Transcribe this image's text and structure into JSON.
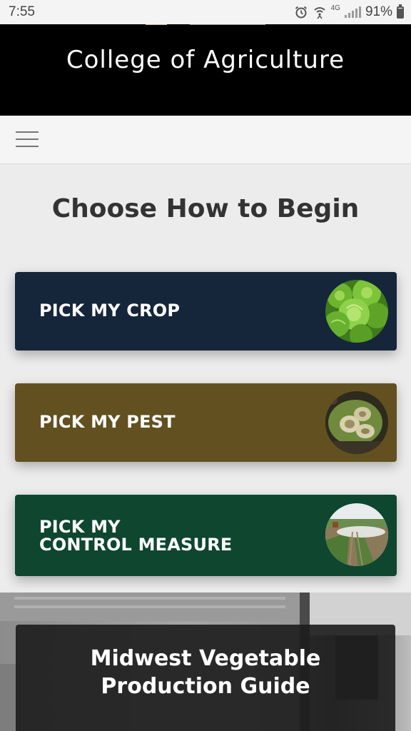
{
  "status_bar": {
    "time": "7:55",
    "network": "4G",
    "battery": "91%",
    "battery_level": 0.91
  },
  "header": {
    "title": "College of Agriculture"
  },
  "nav": {
    "menu_icon": "hamburger-menu-icon"
  },
  "main": {
    "title": "Choose How to Begin",
    "choices": [
      {
        "line1": "PICK MY CROP",
        "line2": "",
        "color": "#15263a",
        "image": "lettuce-image"
      },
      {
        "line1": "PICK MY PEST",
        "line2": "",
        "color": "#625020",
        "image": "pest-leaf-image"
      },
      {
        "line1": "PICK MY",
        "line2": "CONTROL MEASURE",
        "color": "#0e4630",
        "image": "field-spraying-image"
      }
    ]
  },
  "banner": {
    "line1": "Midwest Vegetable",
    "line2": "Production Guide"
  }
}
